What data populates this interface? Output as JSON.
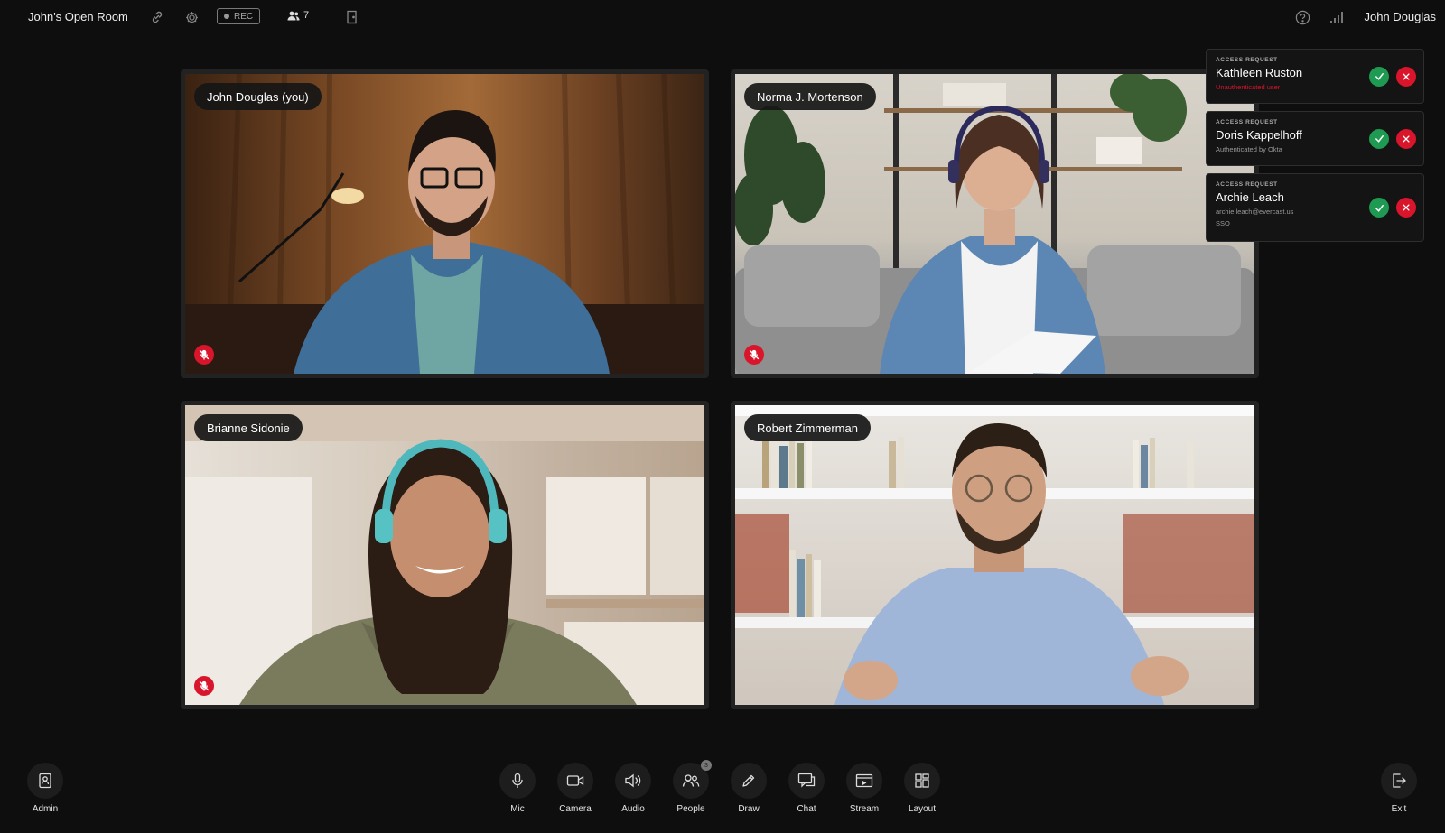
{
  "header": {
    "room_title": "John's Open Room",
    "rec_label": "REC",
    "participant_count": "7",
    "user_name": "John Douglas"
  },
  "tiles": [
    {
      "name": "John Douglas (you)",
      "muted": true
    },
    {
      "name": "Norma J. Mortenson",
      "muted": true
    },
    {
      "name": "Brianne Sidonie",
      "muted": true
    },
    {
      "name": "Robert Zimmerman",
      "muted": false
    }
  ],
  "access_requests": [
    {
      "heading": "ACCESS REQUEST",
      "name": "Kathleen Ruston",
      "detail": "Unauthenticated user",
      "detail2": ""
    },
    {
      "heading": "ACCESS REQUEST",
      "name": "Doris Kappelhoff",
      "detail": "Authenticated by Okta",
      "detail2": ""
    },
    {
      "heading": "ACCESS REQUEST",
      "name": "Archie Leach",
      "detail": "archie.leach@evercast.us",
      "detail2": "SSO"
    }
  ],
  "toolbar": {
    "admin": "Admin",
    "mic": "Mic",
    "camera": "Camera",
    "audio": "Audio",
    "people": "People",
    "people_badge": "3",
    "draw": "Draw",
    "chat": "Chat",
    "stream": "Stream",
    "layout": "Layout",
    "exit": "Exit"
  },
  "colors": {
    "background": "#0e0e0e",
    "mute_red": "#d9152b",
    "accept_green": "#1f9a52",
    "deny_red": "#d9152b"
  }
}
